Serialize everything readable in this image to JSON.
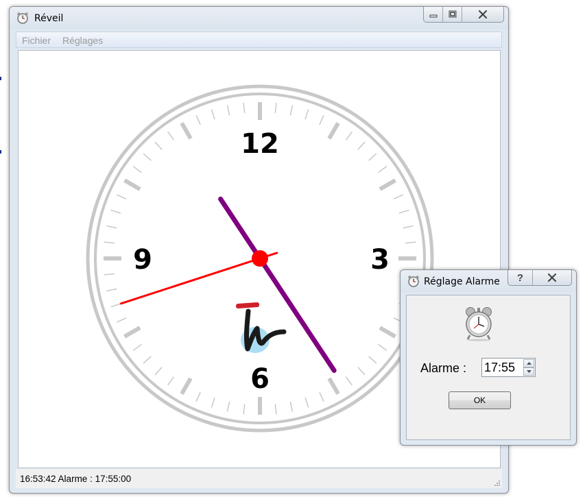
{
  "main_window": {
    "title": "Réveil",
    "menu": [
      "Fichier",
      "Réglages"
    ],
    "status": "16:53:42 Alarme : 17:55:00"
  },
  "clock": {
    "numerals": {
      "n12": "12",
      "n3": "3",
      "n6": "6",
      "n9": "9"
    },
    "time": {
      "hours": 16,
      "minutes": 53,
      "seconds": 42
    },
    "colors": {
      "hour_hand": "#800080",
      "second_hand": "#ff0000",
      "center": "#ff0000",
      "rim": "#c8c8c8",
      "ticks": "#c8c8c8"
    }
  },
  "dialog": {
    "title": "Réglage Alarme",
    "help_glyph": "?",
    "alarm_label": "Alarme :",
    "alarm_value": "17:55",
    "ok_label": "OK"
  },
  "icons": [
    "alarm-clock-icon",
    "minimize-icon",
    "maximize-icon",
    "close-icon",
    "help-icon",
    "spin-up-icon",
    "spin-down-icon",
    "size-grip-icon",
    "logo"
  ]
}
